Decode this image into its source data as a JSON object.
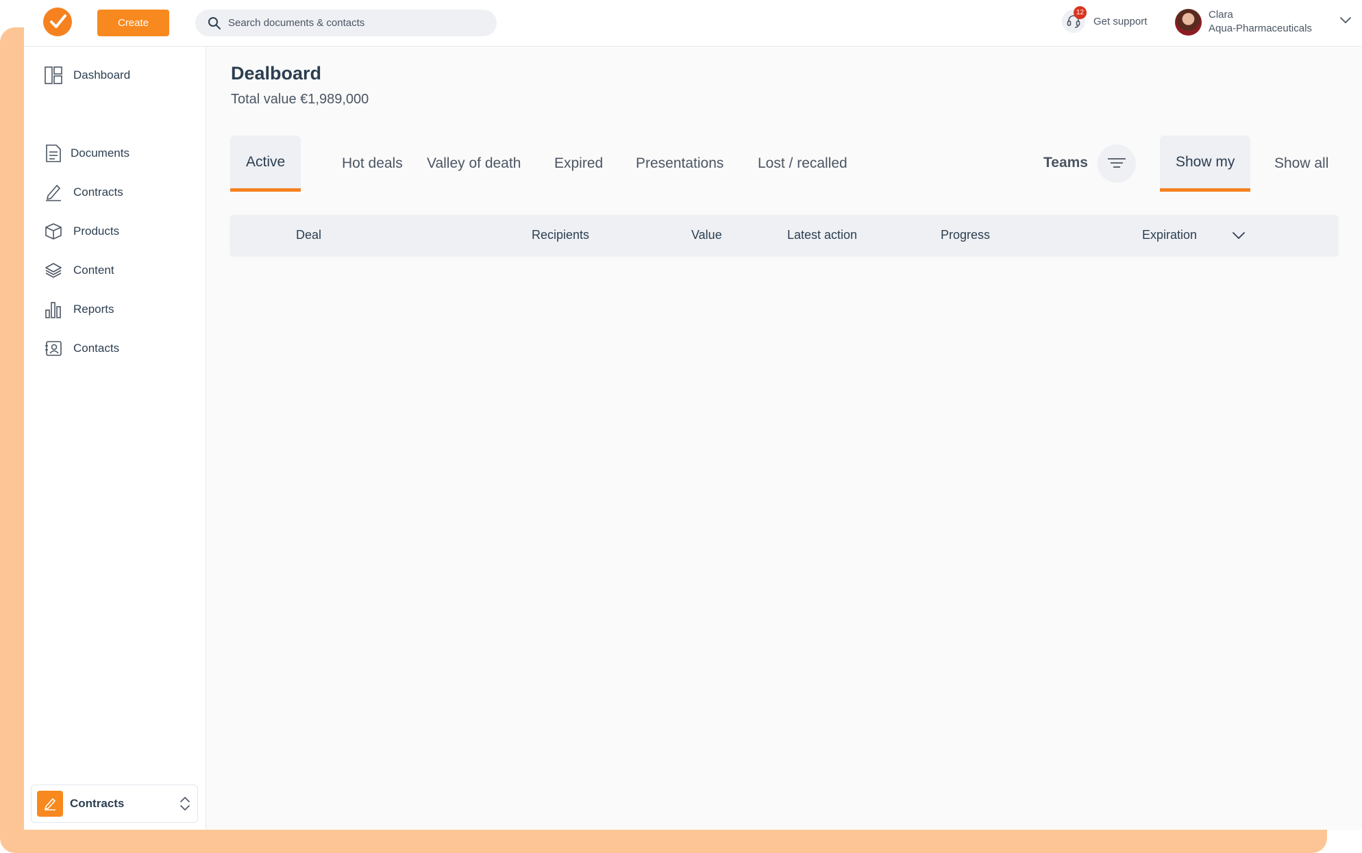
{
  "topbar": {
    "create_label": "Create",
    "search_placeholder": "Search documents & contacts",
    "support_badge": "12",
    "support_label": "Get support",
    "user_name": "Clara",
    "user_company": "Aqua-Pharmaceuticals"
  },
  "sidebar": {
    "items": [
      {
        "label": "Dashboard",
        "icon": "dashboard-icon"
      },
      {
        "label": "Documents",
        "icon": "document-icon"
      },
      {
        "label": "Contracts",
        "icon": "pen-icon"
      },
      {
        "label": "Products",
        "icon": "box-icon"
      },
      {
        "label": "Content",
        "icon": "layers-icon"
      },
      {
        "label": "Reports",
        "icon": "bar-chart-icon"
      },
      {
        "label": "Contacts",
        "icon": "contact-card-icon"
      }
    ],
    "workspace_label": "Contracts"
  },
  "main": {
    "title": "Dealboard",
    "total_value": "Total value €1,989,000",
    "tabs": [
      {
        "label": "Active",
        "active": true
      },
      {
        "label": "Hot deals"
      },
      {
        "label": "Valley of death"
      },
      {
        "label": "Expired"
      },
      {
        "label": "Presentations"
      },
      {
        "label": "Lost / recalled"
      }
    ],
    "teams_label": "Teams",
    "scope_tabs": [
      {
        "label": "Show my",
        "active": true
      },
      {
        "label": "Show all"
      }
    ],
    "table_headers": [
      "Deal",
      "Recipients",
      "Value",
      "Latest action",
      "Progress",
      "Expiration"
    ]
  },
  "colors": {
    "accent": "#f5821f",
    "frame": "#fdc595",
    "badge": "#d9341f"
  }
}
